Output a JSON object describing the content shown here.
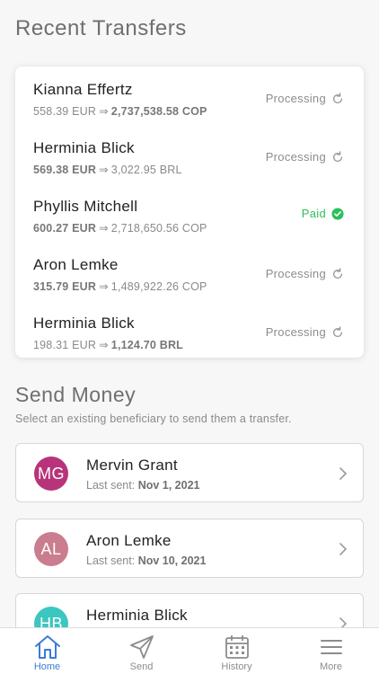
{
  "page_title": "Recent Transfers",
  "transfers": [
    {
      "name": "Kianna Effertz",
      "from": "558.39 EUR",
      "to": "2,737,538.58 COP",
      "bold": "to",
      "status": "Processing",
      "status_type": "processing"
    },
    {
      "name": "Herminia Blick",
      "from": "569.38 EUR",
      "to": "3,022.95 BRL",
      "bold": "from",
      "status": "Processing",
      "status_type": "processing"
    },
    {
      "name": "Phyllis Mitchell",
      "from": "600.27 EUR",
      "to": "2,718,650.56 COP",
      "bold": "from",
      "status": "Paid",
      "status_type": "paid"
    },
    {
      "name": "Aron Lemke",
      "from": "315.79 EUR",
      "to": "1,489,922.26 COP",
      "bold": "from",
      "status": "Processing",
      "status_type": "processing"
    },
    {
      "name": "Herminia Blick",
      "from": "198.31 EUR",
      "to": "1,124.70 BRL",
      "bold": "to",
      "status": "Processing",
      "status_type": "processing"
    }
  ],
  "send_money": {
    "title": "Send Money",
    "subtitle": "Select an existing beneficiary to send them a transfer.",
    "last_sent_label": "Last sent:",
    "beneficiaries": [
      {
        "initials": "MG",
        "name": "Mervin Grant",
        "last_sent": "Nov 1, 2021",
        "color": "#b8347a"
      },
      {
        "initials": "AL",
        "name": "Aron Lemke",
        "last_sent": "Nov 10, 2021",
        "color": "#c97d8e"
      },
      {
        "initials": "HB",
        "name": "Herminia Blick",
        "last_sent": "",
        "color": "#3cc6c0"
      }
    ]
  },
  "tabs": [
    {
      "label": "Home",
      "icon": "home-icon",
      "active": true
    },
    {
      "label": "Send",
      "icon": "send-icon",
      "active": false
    },
    {
      "label": "History",
      "icon": "calendar-icon",
      "active": false
    },
    {
      "label": "More",
      "icon": "menu-icon",
      "active": false
    }
  ],
  "colors": {
    "accent": "#3b7bd6",
    "paid": "#2dbf5b",
    "muted": "#8c8c8c"
  }
}
